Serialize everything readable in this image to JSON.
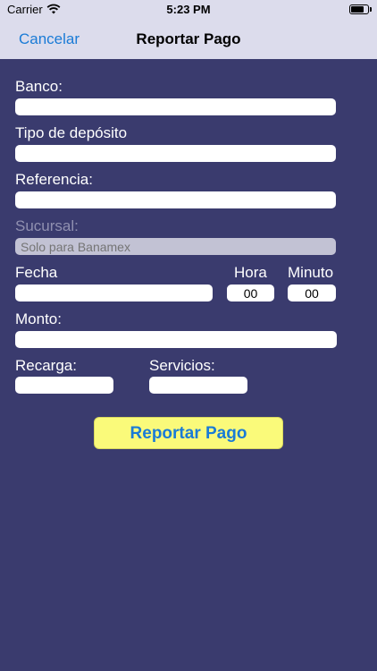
{
  "status_bar": {
    "carrier": "Carrier",
    "time": "5:23 PM"
  },
  "nav": {
    "cancel_label": "Cancelar",
    "title": "Reportar Pago"
  },
  "form": {
    "banco": {
      "label": "Banco:",
      "value": ""
    },
    "tipo_deposito": {
      "label": "Tipo de depósito",
      "value": ""
    },
    "referencia": {
      "label": "Referencia:",
      "value": ""
    },
    "sucursal": {
      "label": "Sucursal:",
      "placeholder": "Solo para Banamex"
    },
    "fecha": {
      "label": "Fecha",
      "value": ""
    },
    "hora": {
      "label": "Hora",
      "value": "00"
    },
    "minuto": {
      "label": "Minuto",
      "value": "00"
    },
    "monto": {
      "label": "Monto:",
      "value": ""
    },
    "recarga": {
      "label": "Recarga:",
      "value": ""
    },
    "servicios": {
      "label": "Servicios:",
      "value": ""
    }
  },
  "submit_label": "Reportar Pago",
  "colors": {
    "background": "#3a3b6e",
    "nav_bg": "#dcdcec",
    "accent": "#1a7bd6",
    "button_bg": "#fafa7a"
  }
}
